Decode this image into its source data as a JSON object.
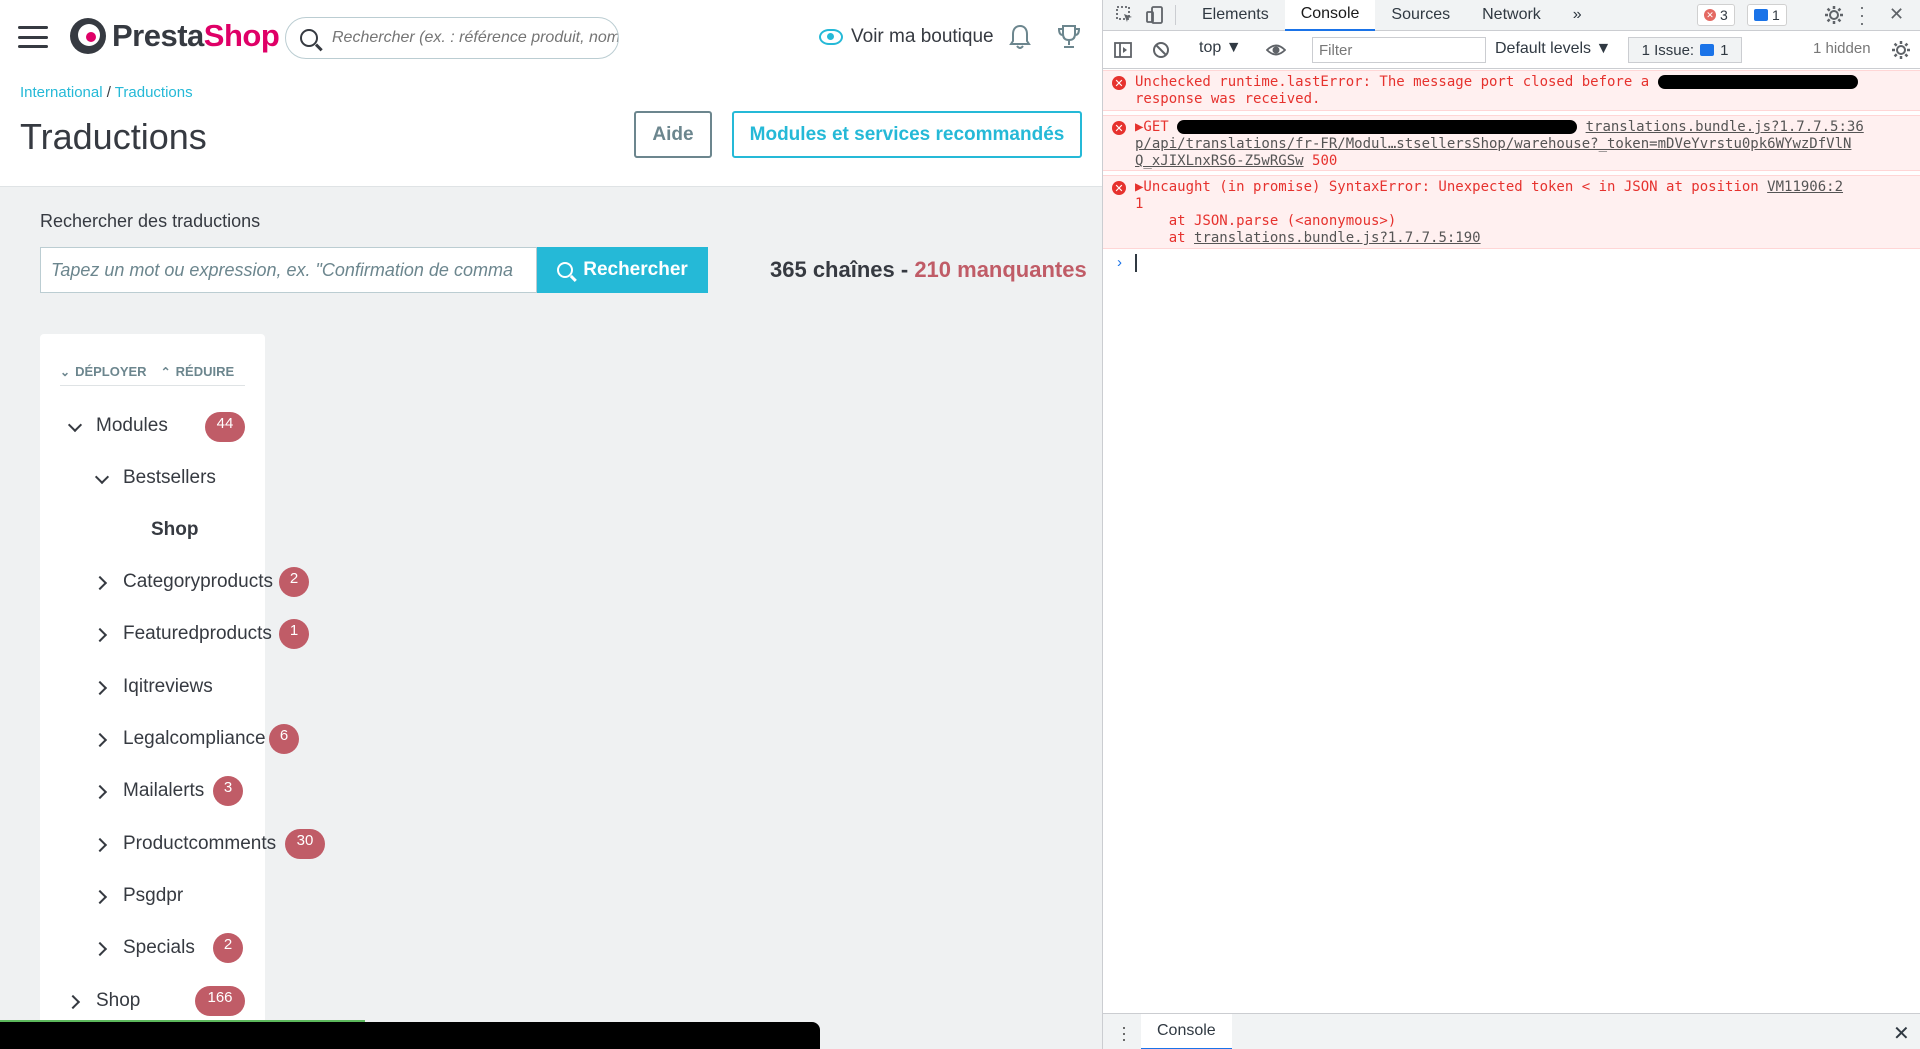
{
  "header": {
    "logo_text_a": "Presta",
    "logo_text_b": "Shop",
    "search_placeholder": "Rechercher (ex. : référence produit, nom",
    "view_shop": "Voir ma boutique"
  },
  "breadcrumb": {
    "parent": "International",
    "sep": " / ",
    "current": "Traductions"
  },
  "page": {
    "title": "Traductions",
    "help_button": "Aide",
    "modules_button": "Modules et services recommandés",
    "search_label": "Rechercher des traductions",
    "search_placeholder": "Tapez un mot ou expression, ex. \"Confirmation de comma",
    "search_button": "Rechercher",
    "strings_count": "365 chaînes",
    "dash": " - ",
    "missing_count": "210 manquantes"
  },
  "tree": {
    "expand": "DÉPLOYER",
    "collapse": "RÉDUIRE",
    "nodes": [
      {
        "label": "Modules",
        "badge": "44"
      },
      {
        "label": "Bestsellers",
        "badge": ""
      },
      {
        "label": "Shop",
        "badge": ""
      },
      {
        "label": "Categoryproducts",
        "badge": "2"
      },
      {
        "label": "Featuredproducts",
        "badge": "1"
      },
      {
        "label": "Iqitreviews",
        "badge": ""
      },
      {
        "label": "Legalcompliance",
        "badge": "6"
      },
      {
        "label": "Mailalerts",
        "badge": "3"
      },
      {
        "label": "Productcomments",
        "badge": "30"
      },
      {
        "label": "Psgdpr",
        "badge": ""
      },
      {
        "label": "Specials",
        "badge": "2"
      },
      {
        "label": "Shop",
        "badge": "166"
      }
    ]
  },
  "devtools": {
    "tabs": [
      "Elements",
      "Console",
      "Sources",
      "Network"
    ],
    "more": "»",
    "error_count": "3",
    "message_count": "1",
    "context": "top ▼",
    "filter_placeholder": "Filter",
    "levels": "Default levels ▼",
    "issues_label": "1 Issue:",
    "issues_count": "1",
    "hidden": "1 hidden",
    "logs": [
      {
        "line1": "Unchecked runtime.lastError: The message port closed before a",
        "line2": "response was received."
      },
      {
        "prefix": "▶GET ",
        "source": "translations.bundle.js?1.7.7.5:36",
        "url_line1": "p/api/translations/fr-FR/Modul…stsellersShop/warehouse?_token=mDVeYvrstu0pk6WYwzDfVlN",
        "url_line2": "Q_xJIXLnxRS6-Z5wRGSw",
        "status": "500"
      },
      {
        "prefix": "▶Uncaught (in promise) SyntaxError: Unexpected token < in JSON at position ",
        "source": "VM11906:2",
        "line2": "1",
        "stack1": "    at JSON.parse (<anonymous>)",
        "stack2_pre": "    at ",
        "stack2_link": "translations.bundle.js?1.7.7.5:190"
      }
    ],
    "prompt": "›",
    "drawer_tab": "Console",
    "close": "✕"
  }
}
